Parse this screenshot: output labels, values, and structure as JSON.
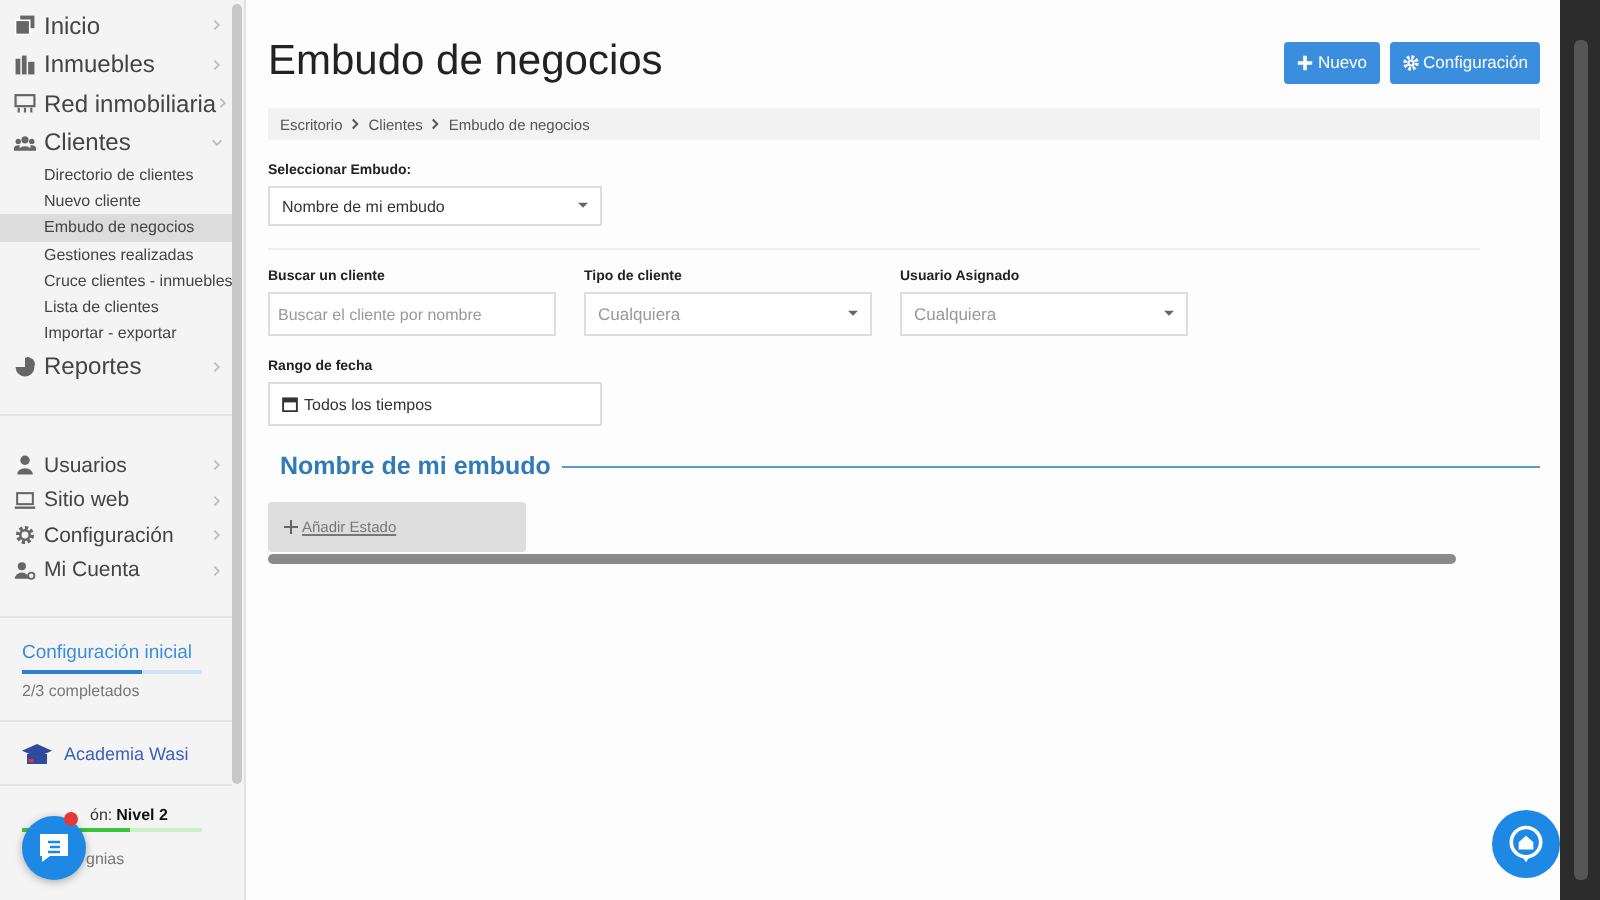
{
  "sidebar": {
    "main_items": [
      {
        "label": "Inicio",
        "expanded": false
      },
      {
        "label": "Inmuebles",
        "expanded": false
      },
      {
        "label": "Red inmobiliaria",
        "expanded": false
      },
      {
        "label": "Clientes",
        "expanded": true,
        "children": [
          {
            "label": "Directorio de clientes",
            "selected": false
          },
          {
            "label": "Nuevo cliente",
            "selected": false
          },
          {
            "label": "Embudo de negocios",
            "selected": true
          },
          {
            "label": "Gestiones realizadas",
            "selected": false
          },
          {
            "label": "Cruce clientes - inmuebles",
            "selected": false
          },
          {
            "label": "Lista de clientes",
            "selected": false
          },
          {
            "label": "Importar - exportar",
            "selected": false
          }
        ]
      },
      {
        "label": "Reportes",
        "expanded": false
      }
    ],
    "account_items": [
      {
        "label": "Usuarios",
        "expanded": false
      },
      {
        "label": "Sitio web",
        "expanded": false
      },
      {
        "label": "Configuración",
        "expanded": false
      },
      {
        "label": "Mi Cuenta",
        "expanded": false
      }
    ],
    "setup": {
      "title": "Configuración inicial",
      "level": 0.67,
      "progress": "2/3 completados"
    },
    "academy": "Academia Wasi",
    "reputation": {
      "label_end": "ón:",
      "value": "Nivel 2",
      "level": 0.6,
      "caption_end": "gnias"
    }
  },
  "page": {
    "title": "Embudo de negocios",
    "buttons": [
      "Nuevo",
      "Configuración"
    ],
    "breadcrumb": [
      "Escritorio",
      "Clientes",
      "Embudo de negocios"
    ],
    "funnel_select": {
      "label": "Seleccionar Embudo:",
      "value": "Nombre de mi embudo"
    },
    "filters": [
      {
        "label": "Buscar un cliente",
        "kind": "text",
        "placeholder": "Buscar el cliente por nombre"
      },
      {
        "label": "Tipo de cliente",
        "kind": "select",
        "placeholder": "Cualquiera"
      },
      {
        "label": "Usuario Asignado",
        "kind": "select",
        "placeholder": "Cualquiera"
      }
    ],
    "date_range": {
      "label": "Rango de fecha",
      "value": "Todos los tiempos"
    },
    "pipeline_title": "Nombre de mi embudo",
    "add_state": "Añadir Estado"
  }
}
